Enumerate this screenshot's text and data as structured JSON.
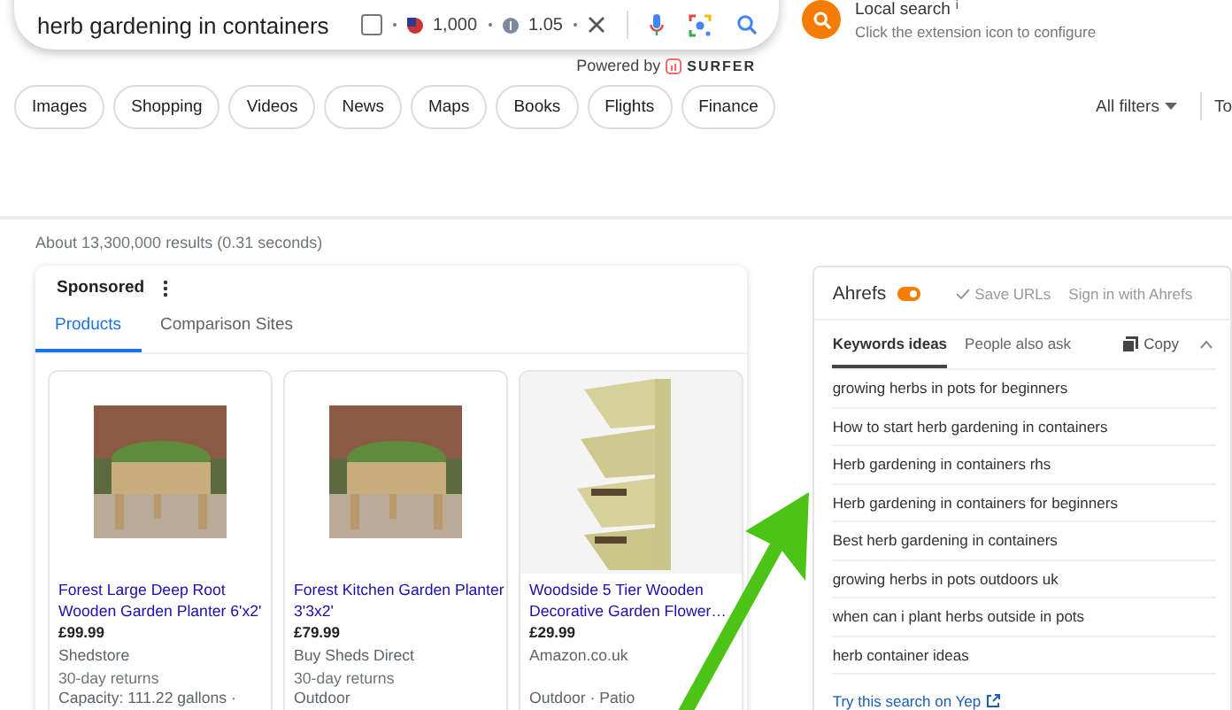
{
  "search": {
    "query": "herb gardening in containers",
    "checked": false,
    "stat_1": "1,000",
    "stat_2": "1.05",
    "powered_by": "Powered by",
    "brand": "SURFER"
  },
  "extension": {
    "title": "Local search",
    "info": "i",
    "subtitle": "Click the extension icon to configure"
  },
  "chips": [
    {
      "label": "Images"
    },
    {
      "label": "Shopping"
    },
    {
      "label": "Videos"
    },
    {
      "label": "News"
    },
    {
      "label": "Maps"
    },
    {
      "label": "Books"
    },
    {
      "label": "Flights"
    },
    {
      "label": "Finance"
    }
  ],
  "all_filters": "All filters",
  "tools": "To",
  "results_count": "About 13,300,000 results (0.31 seconds)",
  "sponsored": {
    "label": "Sponsored",
    "tabs": [
      {
        "label": "Products",
        "selected": true
      },
      {
        "label": "Comparison Sites",
        "selected": false
      }
    ],
    "products": [
      {
        "title": "Forest Large Deep Root Wooden Garden Planter 6'x2'",
        "price": "£99.99",
        "seller": "Shedstore",
        "returns": "30-day returns",
        "detail": "Capacity: 111.22 gallons ·"
      },
      {
        "title": "Forest Kitchen Garden Planter 3'3x2'",
        "price": "£79.99",
        "seller": "Buy Sheds Direct",
        "returns": "30-day returns",
        "detail": "Outdoor"
      },
      {
        "title": "Woodside 5 Tier Wooden Decorative Garden Flower…",
        "price": "£29.99",
        "seller": "Amazon.co.uk",
        "detail": "Outdoor · Patio"
      }
    ]
  },
  "ahrefs": {
    "title": "Ahrefs",
    "on": true,
    "save": "Save URLs",
    "sign_in": "Sign in with Ahrefs",
    "tabs": [
      {
        "label": "Keywords ideas",
        "selected": true
      },
      {
        "label": "People also ask",
        "selected": false
      }
    ],
    "copy": "Copy",
    "expanded": true,
    "keywords": [
      "growing herbs in pots for beginners",
      "How to start herb gardening in containers",
      "Herb gardening in containers rhs",
      "Herb gardening in containers for beginners",
      "Best herb gardening in containers",
      "growing herbs in pots outdoors uk",
      "when can i plant herbs outside in pots",
      "herb container ideas"
    ],
    "yep": "Try this search on Yep"
  }
}
